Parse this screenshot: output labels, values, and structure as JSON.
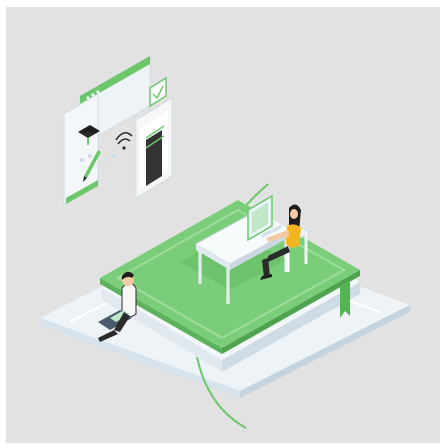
{
  "illustration": {
    "subject": "isometric-online-learning-scene",
    "colors": {
      "background": "#e2e2e2",
      "platform": "#eef3f7",
      "platform_edge": "#cfdde6",
      "accent_green": "#6cc76a",
      "book_cover": "#7bce79",
      "book_pages": "#f4f7f9",
      "floor_tint": "#dde7ef",
      "bookmark": "#54b454",
      "shirt_yellow": "#f2b51e",
      "shirt_white": "#f7f7f7",
      "hair_dark": "#1d1d1d",
      "monitor": "#e8f4f8",
      "outline": "#2b2b2b"
    },
    "icons": [
      "browser-window-icon",
      "ui-panel-icon",
      "wifi-signal-icon",
      "mortarboard-icon",
      "pencil-icon",
      "document-icon",
      "checkbox-icon",
      "open-book-icon",
      "laptop-icon",
      "desk-icon",
      "chair-icon"
    ]
  }
}
